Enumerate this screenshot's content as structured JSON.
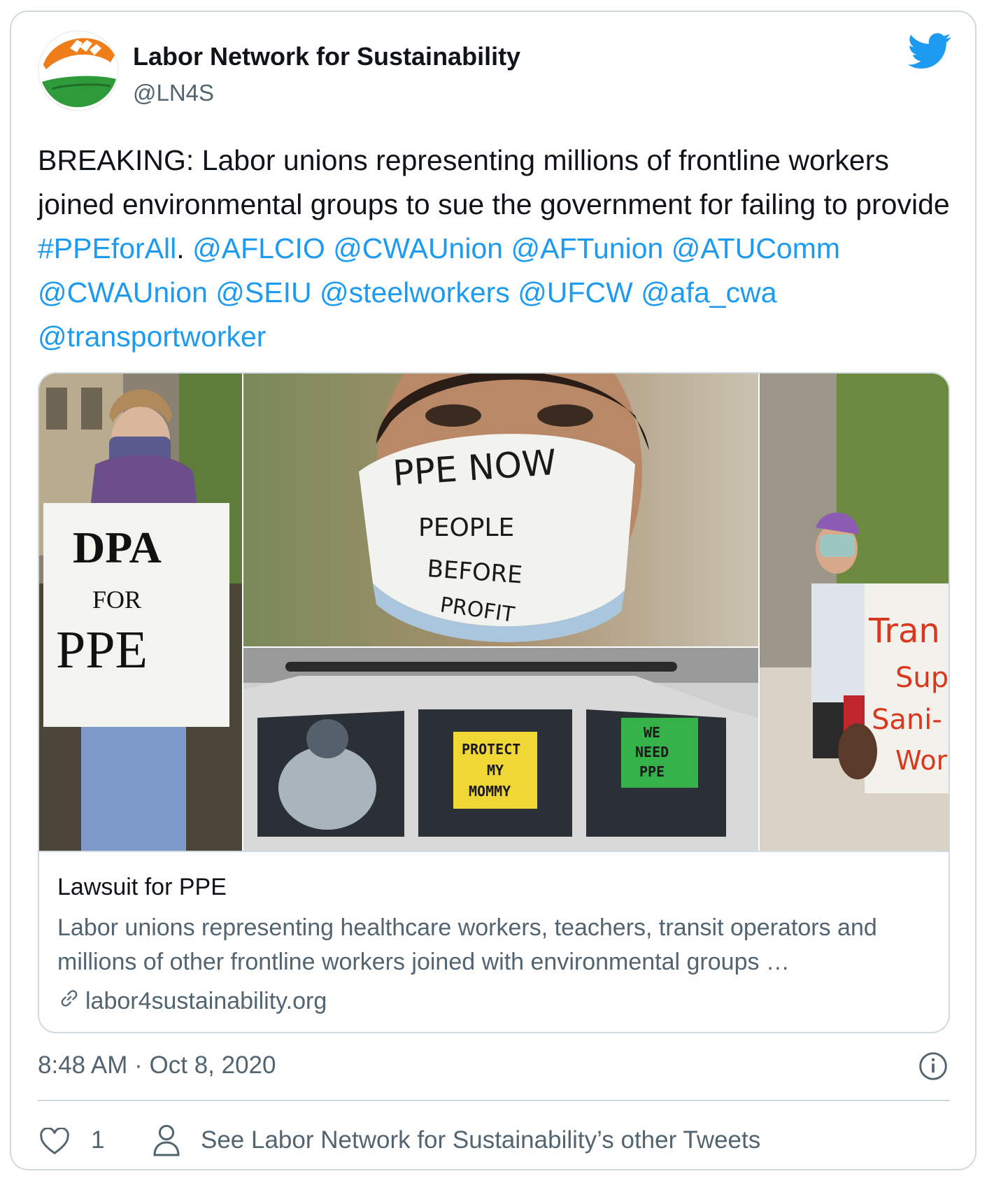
{
  "author": {
    "display_name": "Labor Network for Sustainability",
    "handle": "@LN4S",
    "avatar_icon": "ln4s-logo-icon",
    "platform_icon": "twitter-bird-icon"
  },
  "tweet": {
    "text_plain_1": "BREAKING: Labor unions representing millions of frontline workers joined environmental groups to sue the government for failing to provide ",
    "hashtag": "#PPEforAll",
    "text_plain_2": ". ",
    "mentions": [
      "@AFLCIO",
      "@CWAUnion",
      "@AFTunion",
      "@ATUComm",
      "@CWAUnion",
      "@SEIU",
      "@steelworkers",
      "@UFCW",
      "@afa_cwa",
      "@transportworker"
    ]
  },
  "link_card": {
    "photos": {
      "sign_left": [
        "DPA",
        "FOR",
        "PPE"
      ],
      "mask": [
        "PPE NOW",
        "PEOPLE",
        "BEFORE",
        "PROFIT"
      ],
      "car_sign_yellow": [
        "PROTECT",
        "MY",
        "MOMMY"
      ],
      "car_sign_green": [
        "WE",
        "NEED",
        "PPE"
      ],
      "sign_right": [
        "Tran",
        "Sup",
        "Sani-",
        "Wor"
      ]
    },
    "title": "Lawsuit for PPE",
    "description": "Labor unions representing healthcare workers, teachers, transit operators and millions of other frontline workers joined with environmental groups …",
    "domain": "labor4sustainability.org",
    "domain_icon": "link-icon"
  },
  "meta": {
    "timestamp": "8:48 AM · Oct 8, 2020",
    "info_icon": "info-icon"
  },
  "actions": {
    "like_count": "1",
    "other_tweets_label": "See Labor Network for Sustainability’s other Tweets"
  },
  "colors": {
    "link": "#1d9bf0",
    "text": "#0f1419",
    "secondary": "#536471",
    "border": "#cfd9de"
  }
}
